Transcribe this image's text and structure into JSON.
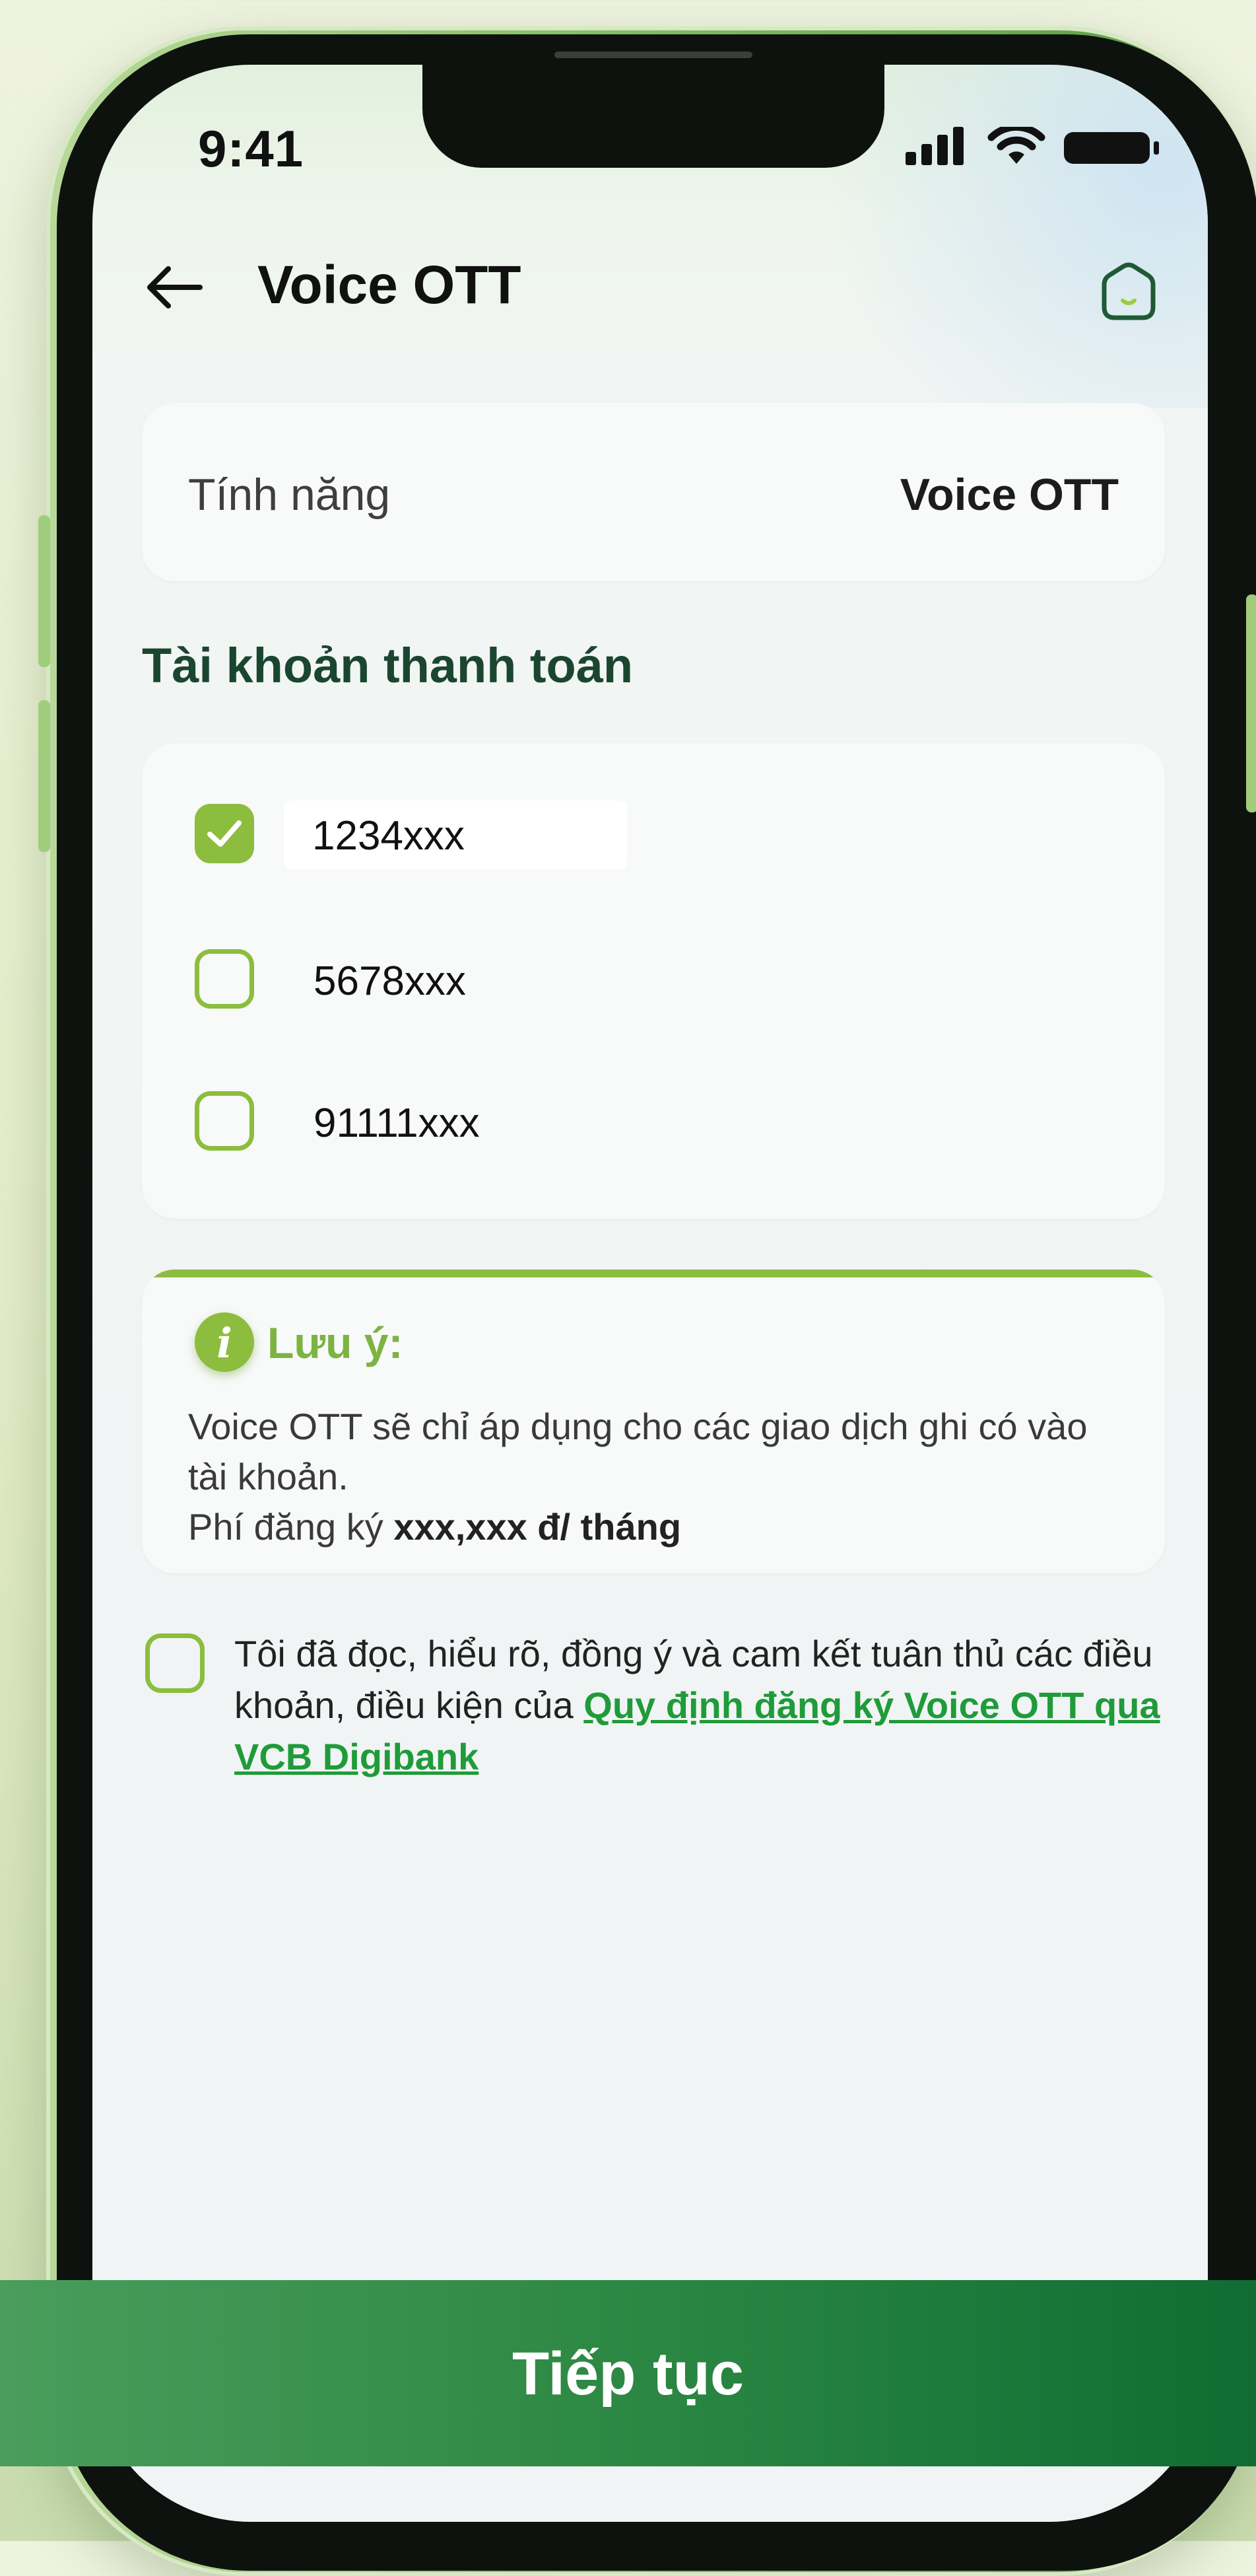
{
  "status_bar": {
    "time": "9:41"
  },
  "header": {
    "title": "Voice OTT"
  },
  "feature_card": {
    "label": "Tính năng",
    "value": "Voice OTT"
  },
  "accounts": {
    "section_title": "Tài khoản thanh toán",
    "items": [
      {
        "number": "1234xxx",
        "checked": true
      },
      {
        "number": "5678xxx",
        "checked": false
      },
      {
        "number": "91111xxx",
        "checked": false
      }
    ]
  },
  "note": {
    "title": "Lưu ý:",
    "line1": "Voice OTT sẽ chỉ áp dụng cho các giao dịch ghi có vào tài khoản.",
    "fee_prefix": "Phí đăng ký ",
    "fee_value": "xxx,xxx đ/ tháng"
  },
  "terms": {
    "checked": false,
    "text": "Tôi đã đọc, hiểu rõ, đồng ý và cam kết tuân thủ các điều khoản, điều kiện của ",
    "link": "Quy định đăng ký Voice OTT qua VCB Digibank"
  },
  "continue_button": {
    "label": "Tiếp tục"
  },
  "colors": {
    "accent_green": "#8cbd3e",
    "title_green": "#1a4630",
    "link_green": "#1f9b3a",
    "button_green": "#1d7b3b"
  },
  "icons": [
    "back-arrow-icon",
    "home-icon",
    "check-icon",
    "info-icon",
    "signal-icon",
    "wifi-icon",
    "battery-icon"
  ]
}
